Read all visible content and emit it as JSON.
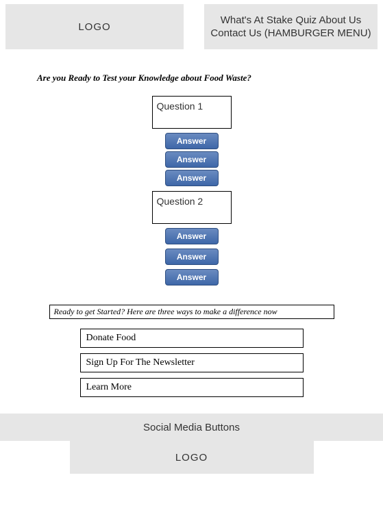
{
  "header": {
    "logo_text": "LOGO",
    "nav_text": "What's At Stake   Quiz  About Us Contact Us (HAMBURGER MENU)"
  },
  "quiz": {
    "title": "Are you Ready to Test your Knowledge about Food Waste?",
    "questions": [
      {
        "label": "Question 1",
        "answers": [
          "Answer",
          "Answer",
          "Answer"
        ]
      },
      {
        "label": "Question 2",
        "answers": [
          "Answer",
          "Answer",
          "Answer"
        ]
      }
    ]
  },
  "cta": {
    "heading": "Ready to get Started? Here are three ways to make a difference now",
    "items": [
      "Donate Food",
      "Sign Up For The Newsletter",
      "Learn More"
    ]
  },
  "footer": {
    "social_label": "Social Media Buttons",
    "logo_text": "LOGO"
  }
}
